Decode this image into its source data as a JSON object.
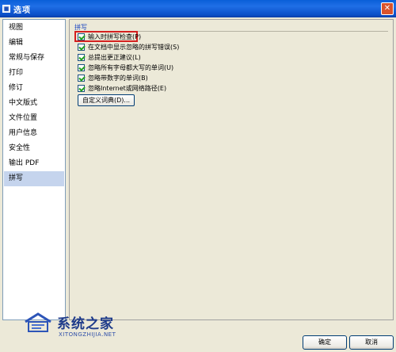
{
  "window": {
    "title": "选项"
  },
  "sidebar": {
    "items": [
      {
        "label": "视图"
      },
      {
        "label": "编辑"
      },
      {
        "label": "常规与保存"
      },
      {
        "label": "打印"
      },
      {
        "label": "修订"
      },
      {
        "label": "中文版式"
      },
      {
        "label": "文件位置"
      },
      {
        "label": "用户信息"
      },
      {
        "label": "安全性"
      },
      {
        "label": "输出 PDF"
      },
      {
        "label": "拼写"
      }
    ],
    "selected": "拼写"
  },
  "panel": {
    "header": "拼写",
    "checkboxes": [
      {
        "label": "输入时拼写检查(P)",
        "checked": true
      },
      {
        "label": "在文档中显示忽略的拼写错误(S)",
        "checked": true
      },
      {
        "label": "总提出更正建议(L)",
        "checked": true
      },
      {
        "label": "忽略所有字母都大写的单词(U)",
        "checked": true
      },
      {
        "label": "忽略带数字的单词(B)",
        "checked": true
      },
      {
        "label": "忽略Internet或网络路径(E)",
        "checked": true
      }
    ],
    "custom_dict_button": "自定义词典(D)..."
  },
  "footer": {
    "ok": "确定",
    "cancel": "取消"
  },
  "watermark": {
    "title": "系统之家",
    "subtitle": "XITONGZHIJIA.NET"
  },
  "colors": {
    "titlebar": "#0a5fd8",
    "selected_item": "#c5d4ed",
    "highlight": "#d4201f",
    "header_text": "#1c46c0"
  }
}
